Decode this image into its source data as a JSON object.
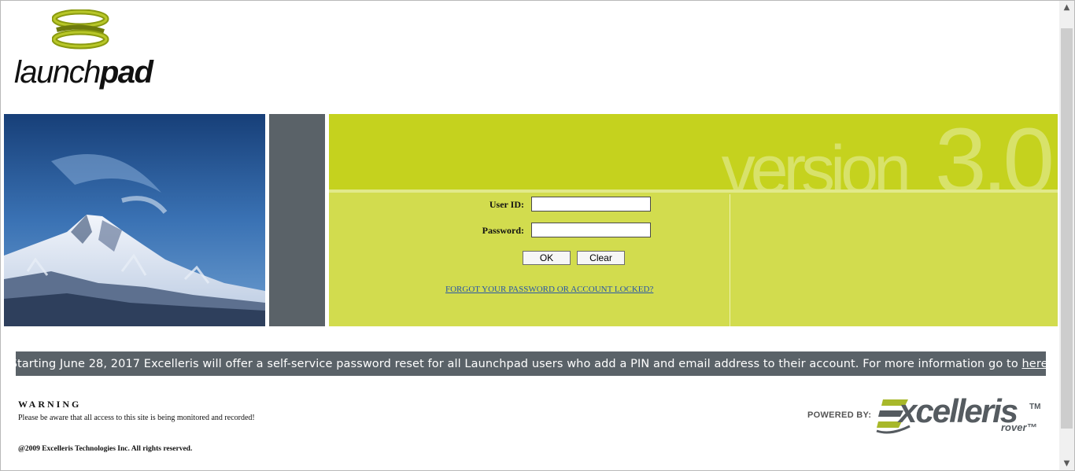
{
  "logo": {
    "text_light": "launch",
    "text_bold": "pad"
  },
  "header": {
    "version_word": "version",
    "version_number": "3.0"
  },
  "form": {
    "user_id_label": "User ID:",
    "user_id_value": "",
    "password_label": "Password:",
    "password_value": "",
    "ok_label": "OK",
    "clear_label": "Clear",
    "forgot_link": "FORGOT YOUR PASSWORD OR ACCOUNT LOCKED?"
  },
  "banner": {
    "text": "Starting June 28, 2017 Excelleris will offer a self-service password reset for all Launchpad users who add a PIN and email address to their account. For more information go to ",
    "link_text": "here",
    "suffix": "."
  },
  "warning": {
    "title": "WARNING",
    "text": "Please be aware that all access to this site is being monitored and recorded!"
  },
  "copyright": "@2009 Excelleris Technologies Inc. All rights reserved.",
  "powered": {
    "label": "POWERED BY:",
    "brand": "xcelleris",
    "brand_tm": "TM",
    "sub_brand": "rover™"
  },
  "colors": {
    "accent_green": "#c5d21e",
    "panel_green": "#d2dc4e",
    "slate": "#5a6268"
  },
  "icons": {
    "scroll_up": "chevron-up-icon",
    "scroll_down": "chevron-down-icon"
  }
}
